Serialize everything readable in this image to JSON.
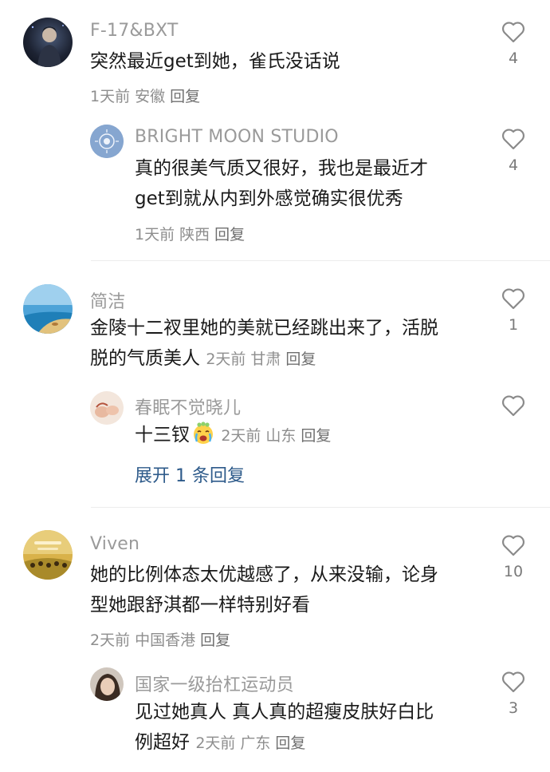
{
  "threads": [
    {
      "comment": {
        "user": "F-17&BXT",
        "text_lines": [
          "突然最近get到她，雀氏没话说"
        ],
        "time": "1天前",
        "location": "安徽",
        "reply_label": "回复",
        "likes": "4"
      },
      "replies": [
        {
          "user": "BRIGHT MOON STUDIO",
          "text_lines": [
            "真的很美气质又很好，我也是最近才",
            "get到就从内到外感觉确实很优秀"
          ],
          "time": "1天前",
          "location": "陕西",
          "reply_label": "回复",
          "likes": "4"
        }
      ]
    },
    {
      "comment": {
        "user": "简洁",
        "text_lines": [
          "金陵十二衩里她的美就已经跳出来了，活脱",
          "脱的气质美人"
        ],
        "time": "2天前",
        "location": "甘肃",
        "reply_label": "回复",
        "likes": "1"
      },
      "replies": [
        {
          "user": "春眠不觉晓儿",
          "text_lines": [
            "十三钗"
          ],
          "time": "2天前",
          "location": "山东",
          "reply_label": "回复",
          "likes": ""
        }
      ],
      "expand_label": "展开 1 条回复"
    },
    {
      "comment": {
        "user": "Viven",
        "text_lines": [
          "她的比例体态太优越感了，从来没输，论身",
          "型她跟舒淇都一样特别好看"
        ],
        "time": "2天前",
        "location": "中国香港",
        "reply_label": "回复",
        "likes": "10"
      },
      "replies": [
        {
          "user": "国家一级抬杠运动员",
          "text_lines": [
            "见过她真人  真人真的超瘦皮肤好白比",
            "例超好"
          ],
          "time": "2天前",
          "location": "广东",
          "reply_label": "回复",
          "likes": "3"
        }
      ]
    }
  ],
  "icons": {
    "like": "heart-outline-icon",
    "emoji": "crying-face-emoji"
  },
  "colors": {
    "username": "#9a9a9a",
    "meta": "#8e8e8e",
    "expand_link": "#2d5a8a",
    "divider": "#ececec"
  }
}
